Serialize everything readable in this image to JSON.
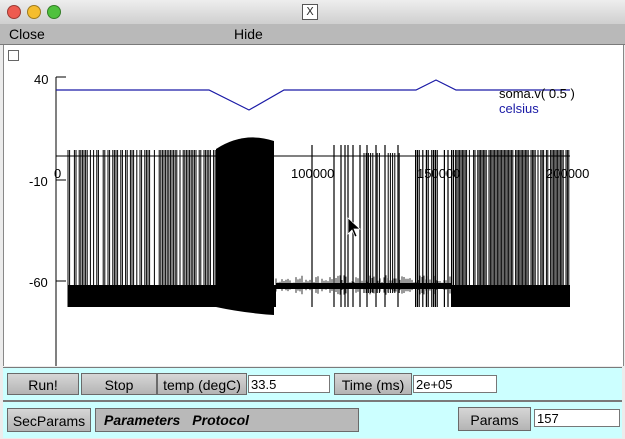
{
  "window": {
    "close_glyph": "X"
  },
  "menu": {
    "close_label": "Close",
    "hide_label": "Hide"
  },
  "plot": {
    "y_ticks": [
      "40",
      "-10",
      "-60"
    ],
    "x_ticks": [
      "0",
      "100000",
      "150000",
      "200000"
    ],
    "legend": {
      "voltage_label": "soma.v( 0.5 )",
      "celsius_label": "celsius"
    },
    "colors": {
      "voltage": "#000000",
      "celsius": "#1a1aa6"
    }
  },
  "controls": {
    "run_label": "Run!",
    "stop_label": "Stop",
    "temp_label": "temp (degC)",
    "temp_value": "33.5",
    "time_label": "Time (ms)",
    "time_value": "2e+05",
    "secparams_label": "SecParams",
    "parameters_label": "Parameters",
    "protocol_label": "Protocol",
    "params_label": "Params",
    "params_value": "157"
  }
}
